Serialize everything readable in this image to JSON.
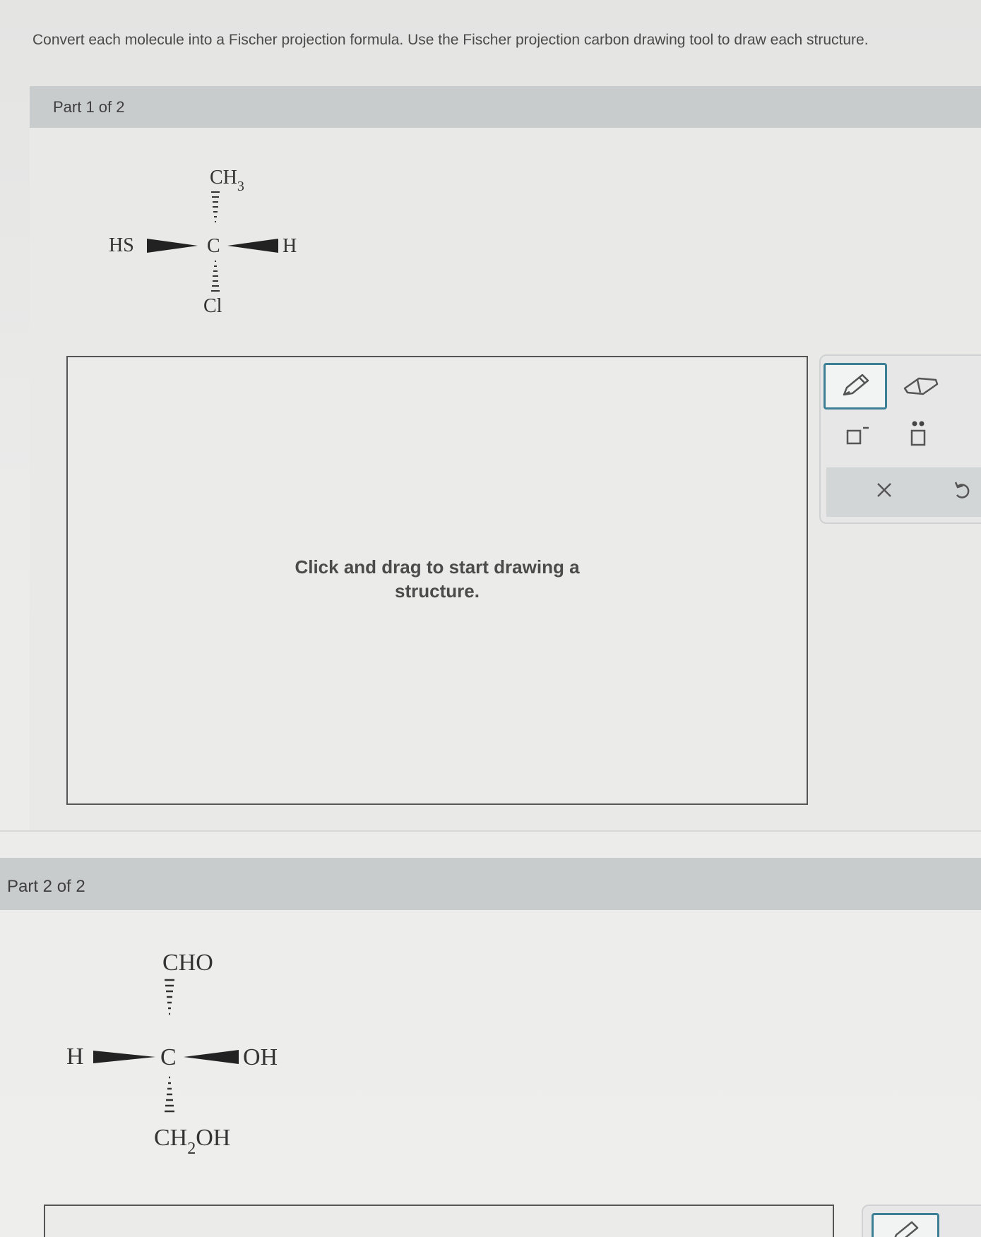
{
  "instructions": "Convert each molecule into a Fischer projection formula. Use the Fischer projection carbon drawing tool to draw each structure.",
  "part1": {
    "header": "Part 1 of 2",
    "molecule": {
      "top": "CH",
      "top_subscript": "3",
      "left": "HS",
      "center": "C",
      "right": "H",
      "bottom": "Cl"
    },
    "canvas_hint_line1": "Click and drag to start drawing a",
    "canvas_hint_line2": "structure."
  },
  "part2": {
    "header": "Part 2 of 2",
    "molecule": {
      "top": "CHO",
      "left": "H",
      "center": "C",
      "right": "OH",
      "bottom_a": "CH",
      "bottom_subscript": "2",
      "bottom_b": "OH"
    }
  },
  "toolbar": {
    "tools": [
      "pencil-icon",
      "eraser-icon",
      "charge-icon",
      "lone-pair-icon",
      "close-icon",
      "undo-icon"
    ],
    "selected": "pencil-icon",
    "accent_color": "#3d7f94"
  }
}
